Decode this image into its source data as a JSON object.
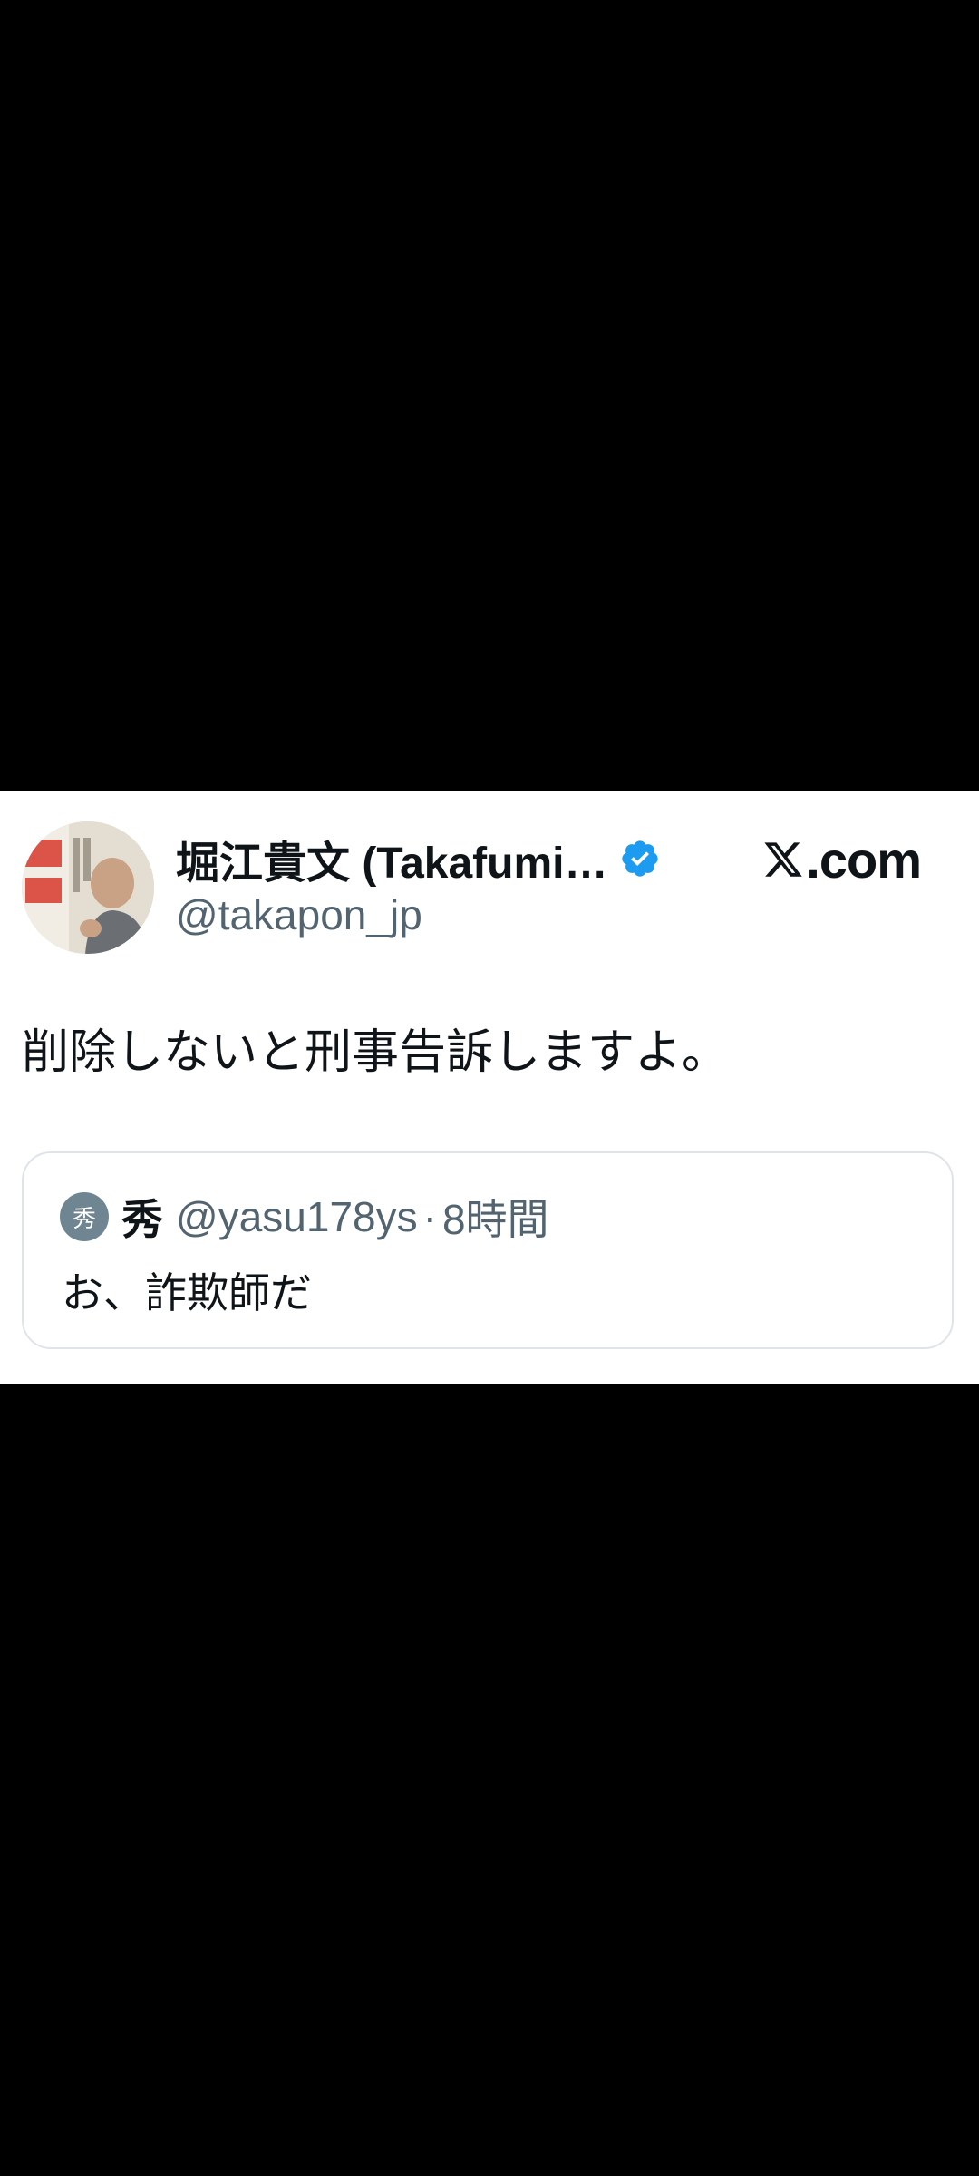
{
  "tweet": {
    "author": {
      "display_name": "堀江貴文 (Takafumi…",
      "handle": "@takapon_jp",
      "avatar_icon": "profile-photo",
      "verified": true
    },
    "brand": {
      "logo_icon": "x-logo-icon",
      "domain": ".com"
    },
    "text": "削除しないと刑事告訴しますよ。",
    "quote": {
      "avatar_label": "秀",
      "name": "秀",
      "handle": "@yasu178ys",
      "separator": "·",
      "time": "8時間",
      "text": "お、詐欺師だ"
    }
  },
  "colors": {
    "background": "#000000",
    "card": "#ffffff",
    "primary_text": "#0f1419",
    "secondary_text": "#536471",
    "verified_badge": "#1d9bf0",
    "quote_border": "#dfe4e8",
    "quote_avatar": "#6f8592"
  }
}
